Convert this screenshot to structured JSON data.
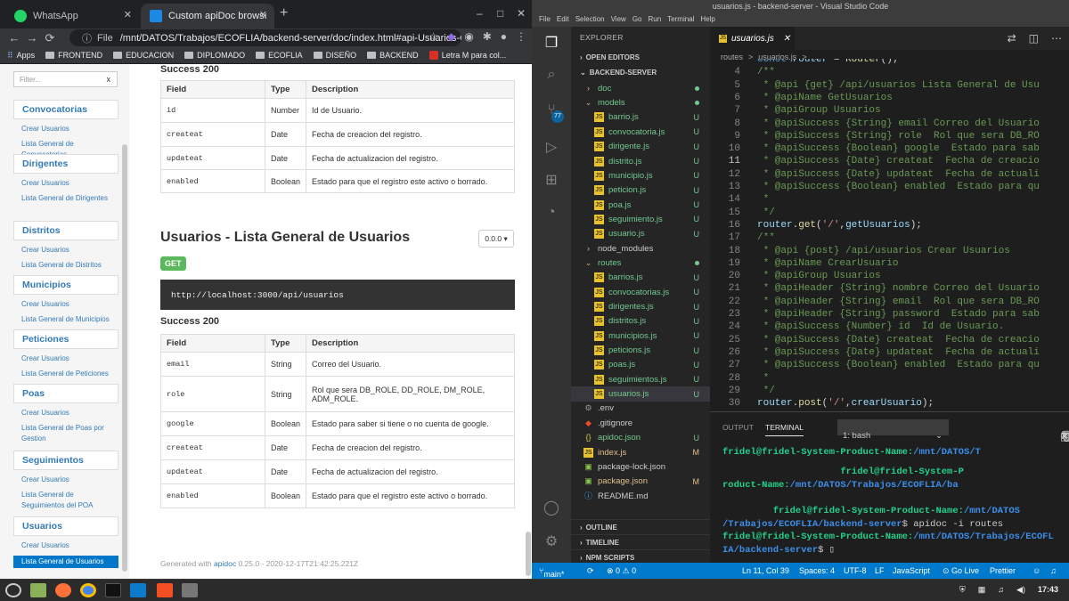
{
  "chrome": {
    "tabs": [
      {
        "label": "WhatsApp",
        "fav": "#25d366"
      },
      {
        "label": "Custom apiDoc browser title",
        "fav": "#1e88e5"
      }
    ],
    "newtab": "+",
    "minimize": "–",
    "maximize": "□",
    "close": "✕",
    "back": "←",
    "forward": "→",
    "reload": "⟳",
    "url_prefix": "File",
    "url_path": "/mnt/DATOS/Trabajos/ECOFLIA/backend-server/doc/index.html#api-Usuarios-GetUsu...",
    "bookmarks": [
      "Apps",
      "FRONTEND",
      "EDUCACION",
      "DIPLOMADO",
      "ECOFLIA",
      "DISEÑO",
      "BACKEND",
      "Letra M para col..."
    ],
    "filter_placeholder": "Filter...",
    "filter_clear": "x",
    "nav": [
      {
        "title": "Convocatorias",
        "links": [
          "Crear Usuarios",
          "Lista General de Convocatorias"
        ]
      },
      {
        "title": "Dirigentes",
        "links": [
          "Crear Usuarios",
          "Lista General de Dirigentes"
        ]
      },
      {
        "title": "Distritos",
        "links": [
          "Crear Usuarios",
          "Lista General de Distritos"
        ]
      },
      {
        "title": "Municipios",
        "links": [
          "Crear Usuarios",
          "Lista General de Municipios"
        ]
      },
      {
        "title": "Peticiones",
        "links": [
          "Crear Usuarios",
          "Lista General de Peticiones"
        ]
      },
      {
        "title": "Poas",
        "links": [
          "Crear Usuarios",
          "Lista General de Poas por Gestion"
        ]
      },
      {
        "title": "Seguimientos",
        "links": [
          "Crear Usuarios",
          "Lista General de Seguimientos del POA"
        ]
      },
      {
        "title": "Usuarios",
        "links": [
          "Crear Usuarios",
          "Lista General de Usuarios"
        ]
      }
    ],
    "success1": "Success 200",
    "headers": [
      "Field",
      "Type",
      "Description"
    ],
    "table1": [
      [
        "id",
        "Number",
        "Id de Usuario."
      ],
      [
        "createat",
        "Date",
        "Fecha de creacion del registro."
      ],
      [
        "updateat",
        "Date",
        "Fecha de actualizacion del registro."
      ],
      [
        "enabled",
        "Boolean",
        "Estado para que el registro este activo o borrado."
      ]
    ],
    "section_title": "Usuarios - Lista General de Usuarios",
    "version": "0.0.0 ▾",
    "method": "GET",
    "endpoint": "http://localhost:3000/api/usuarios",
    "success2": "Success 200",
    "table2": [
      [
        "email",
        "String",
        "Correo del Usuario."
      ],
      [
        "role",
        "String",
        "Rol que sera DB_ROLE, DD_ROLE, DM_ROLE, ADM_ROLE."
      ],
      [
        "google",
        "Boolean",
        "Estado para saber si tiene o no cuenta de google."
      ],
      [
        "createat",
        "Date",
        "Fecha de creacion del registro."
      ],
      [
        "updateat",
        "Date",
        "Fecha de actualizacion del registro."
      ],
      [
        "enabled",
        "Boolean",
        "Estado para que el registro este activo o borrado."
      ]
    ],
    "generated_pre": "Generated with ",
    "generated_link": "apidoc",
    "generated_post": " 0.25.0 - 2020-12-17T21:42:25.221Z"
  },
  "vscode": {
    "title": "usuarios.js - backend-server - Visual Studio Code",
    "menu": [
      "File",
      "Edit",
      "Selection",
      "View",
      "Go",
      "Run",
      "Terminal",
      "Help"
    ],
    "explorer": "EXPLORER",
    "open_editors": "OPEN EDITORS",
    "project": "BACKEND-SERVER",
    "badge": "77",
    "tree": [
      {
        "label": "doc",
        "kind": "folder",
        "indent": 1,
        "cls": "green",
        "stat": "dot"
      },
      {
        "label": "models",
        "kind": "folder-open",
        "indent": 1,
        "cls": "green",
        "stat": "dot"
      },
      {
        "label": "barrio.js",
        "kind": "js",
        "indent": 2,
        "cls": "green",
        "stat": "U"
      },
      {
        "label": "convocatoria.js",
        "kind": "js",
        "indent": 2,
        "cls": "green",
        "stat": "U"
      },
      {
        "label": "dirigente.js",
        "kind": "js",
        "indent": 2,
        "cls": "green",
        "stat": "U"
      },
      {
        "label": "distrito.js",
        "kind": "js",
        "indent": 2,
        "cls": "green",
        "stat": "U"
      },
      {
        "label": "municipio.js",
        "kind": "js",
        "indent": 2,
        "cls": "green",
        "stat": "U"
      },
      {
        "label": "peticion.js",
        "kind": "js",
        "indent": 2,
        "cls": "green",
        "stat": "U"
      },
      {
        "label": "poa.js",
        "kind": "js",
        "indent": 2,
        "cls": "green",
        "stat": "U"
      },
      {
        "label": "seguimiento.js",
        "kind": "js",
        "indent": 2,
        "cls": "green",
        "stat": "U"
      },
      {
        "label": "usuario.js",
        "kind": "js",
        "indent": 2,
        "cls": "green",
        "stat": "U"
      },
      {
        "label": "node_modules",
        "kind": "folder",
        "indent": 1,
        "cls": "",
        "stat": ""
      },
      {
        "label": "routes",
        "kind": "folder-open",
        "indent": 1,
        "cls": "green",
        "stat": "dot"
      },
      {
        "label": "barrios.js",
        "kind": "js",
        "indent": 2,
        "cls": "green",
        "stat": "U"
      },
      {
        "label": "convocatorias.js",
        "kind": "js",
        "indent": 2,
        "cls": "green",
        "stat": "U"
      },
      {
        "label": "dirigentes.js",
        "kind": "js",
        "indent": 2,
        "cls": "green",
        "stat": "U"
      },
      {
        "label": "distritos.js",
        "kind": "js",
        "indent": 2,
        "cls": "green",
        "stat": "U"
      },
      {
        "label": "municipios.js",
        "kind": "js",
        "indent": 2,
        "cls": "green",
        "stat": "U"
      },
      {
        "label": "peticions.js",
        "kind": "js",
        "indent": 2,
        "cls": "green",
        "stat": "U"
      },
      {
        "label": "poas.js",
        "kind": "js",
        "indent": 2,
        "cls": "green",
        "stat": "U"
      },
      {
        "label": "seguimientos.js",
        "kind": "js",
        "indent": 2,
        "cls": "green",
        "stat": "U"
      },
      {
        "label": "usuarios.js",
        "kind": "js",
        "indent": 2,
        "cls": "green sel",
        "stat": "U"
      },
      {
        "label": ".env",
        "kind": "cfg",
        "indent": 1,
        "cls": "",
        "stat": ""
      },
      {
        "label": ".gitignore",
        "kind": "git",
        "indent": 1,
        "cls": "",
        "stat": ""
      },
      {
        "label": "apidoc.json",
        "kind": "json",
        "indent": 1,
        "cls": "green",
        "stat": "U"
      },
      {
        "label": "index.js",
        "kind": "js",
        "indent": 1,
        "cls": "orange",
        "stat": "M"
      },
      {
        "label": "package-lock.json",
        "kind": "npm",
        "indent": 1,
        "cls": "",
        "stat": ""
      },
      {
        "label": "package.json",
        "kind": "npm",
        "indent": 1,
        "cls": "orange",
        "stat": "M"
      },
      {
        "label": "README.md",
        "kind": "md",
        "indent": 1,
        "cls": "",
        "stat": ""
      }
    ],
    "outline": "OUTLINE",
    "timeline": "TIMELINE",
    "npm": "NPM SCRIPTS",
    "tab_label": "usuarios.js",
    "breadcrumb": [
      "routes",
      ">",
      "usuarios.js",
      ">",
      "..."
    ],
    "code": [
      {
        "n": "",
        "html": "<span class='k'>const</span> <span class='v'>router</span> <span class='w'>=</span> <span class='fn'>Router</span><span class='w'>();</span>"
      },
      {
        "n": "4",
        "html": "<span class='c'>/**</span>"
      },
      {
        "n": "5",
        "html": "<span class='c'> * @api {get} /api/usuarios Lista General de Usu</span>"
      },
      {
        "n": "6",
        "html": "<span class='c'> * @apiName GetUsuarios</span>"
      },
      {
        "n": "7",
        "html": "<span class='c'> * @apiGroup Usuarios</span>"
      },
      {
        "n": "8",
        "html": "<span class='c'> * @apiSuccess {String} email Correo del Usuario</span>"
      },
      {
        "n": "9",
        "html": "<span class='c'> * @apiSuccess {String} role  Rol que sera DB_RO</span>"
      },
      {
        "n": "10",
        "html": "<span class='c'> * @apiSuccess {Boolean} google  Estado para sab</span>"
      },
      {
        "n": "11",
        "html": "<span class='c'> * @apiSuccess {Date} createat  Fecha de creacio</span>"
      },
      {
        "n": "12",
        "html": "<span class='c'> * @apiSuccess {Date} updateat  Fecha de actuali</span>"
      },
      {
        "n": "13",
        "html": "<span class='c'> * @apiSuccess {Boolean} enabled  Estado para qu</span>"
      },
      {
        "n": "14",
        "html": "<span class='c'> *</span>"
      },
      {
        "n": "15",
        "html": "<span class='c'> */</span>"
      },
      {
        "n": "16",
        "html": "<span class='v'>router</span><span class='w'>.</span><span class='fn'>get</span><span class='w'>(</span><span class='s'>'/'</span><span class='w'>,</span><span class='v'>getUsuarios</span><span class='w'>);</span>"
      },
      {
        "n": "17",
        "html": "<span class='c'>/**</span>"
      },
      {
        "n": "18",
        "html": "<span class='c'> * @api {post} /api/usuarios Crear Usuarios</span>"
      },
      {
        "n": "19",
        "html": "<span class='c'> * @apiName CrearUsuario</span>"
      },
      {
        "n": "20",
        "html": "<span class='c'> * @apiGroup Usuarios</span>"
      },
      {
        "n": "21",
        "html": "<span class='c'> * @apiHeader {String} nombre Correo del Usuario</span>"
      },
      {
        "n": "22",
        "html": "<span class='c'> * @apiHeader {String} email  Rol que sera DB_RO</span>"
      },
      {
        "n": "23",
        "html": "<span class='c'> * @apiHeader {String} password  Estado para sab</span>"
      },
      {
        "n": "24",
        "html": "<span class='c'> * @apiSuccess {Number} id  Id de Usuario.</span>"
      },
      {
        "n": "25",
        "html": "<span class='c'> * @apiSuccess {Date} createat  Fecha de creacio</span>"
      },
      {
        "n": "26",
        "html": "<span class='c'> * @apiSuccess {Date} updateat  Fecha de actuali</span>"
      },
      {
        "n": "27",
        "html": "<span class='c'> * @apiSuccess {Boolean} enabled  Estado para qu</span>"
      },
      {
        "n": "28",
        "html": "<span class='c'> *</span>"
      },
      {
        "n": "29",
        "html": "<span class='c'> */</span>"
      },
      {
        "n": "30",
        "html": "<span class='v'>router</span><span class='w'>.</span><span class='fn'>post</span><span class='w'>(</span><span class='s'>'/'</span><span class='w'>,</span><span class='v'>crearUsuario</span><span class='w'>);</span>"
      }
    ],
    "panel_tabs": [
      "OUTPUT",
      "TERMINAL"
    ],
    "terminal_select": "1: bash",
    "status": {
      "branch": "main*",
      "sync": "⟳",
      "problems": "⊗ 0 ⚠ 0",
      "pos": "Ln 11, Col 39",
      "spaces": "Spaces: 4",
      "enc": "UTF-8",
      "eol": "LF",
      "lang": "JavaScript",
      "live": "⊙ Go Live",
      "prettier": "Prettier"
    }
  },
  "taskbar": {
    "clock": "17:43"
  }
}
